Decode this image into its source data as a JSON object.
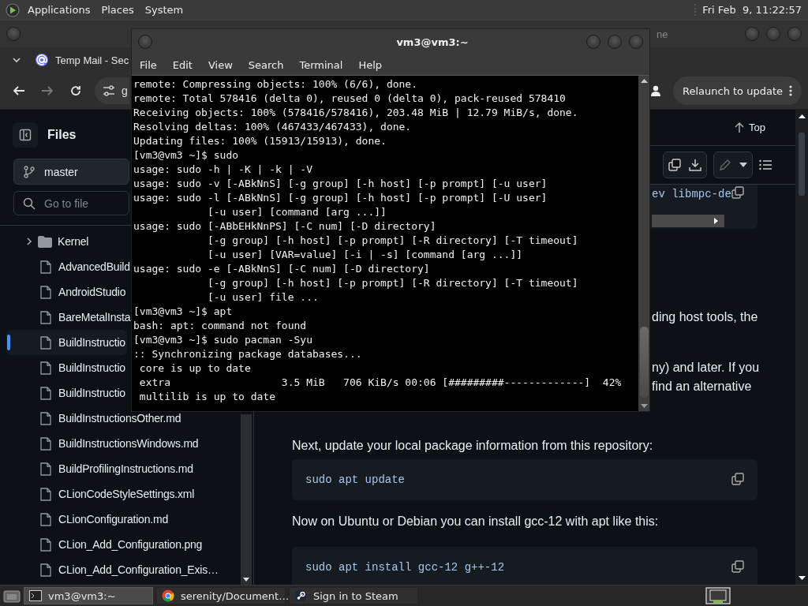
{
  "top_panel": {
    "menus": [
      "Applications",
      "Places",
      "System"
    ],
    "clock": "Fri Feb  9, 11:22:57"
  },
  "browser": {
    "title": "ne",
    "tab": {
      "title": "Temp Mail - Sec"
    },
    "nav": [
      {
        "kind": "back",
        "disabled": false
      },
      {
        "kind": "forward",
        "disabled": true
      },
      {
        "kind": "reload",
        "disabled": false
      }
    ],
    "address": "g",
    "update_button": "Relaunch to update",
    "sidebar": {
      "title": "Files",
      "branch": "master",
      "search": {
        "placeholder": "Go to file"
      },
      "tree": [
        {
          "name": "Kernel",
          "kind": "folder",
          "expanded": false,
          "selected": false
        },
        {
          "name": "AdvancedBuild",
          "kind": "file",
          "selected": false
        },
        {
          "name": "AndroidStudio",
          "kind": "file",
          "selected": false
        },
        {
          "name": "BareMetalInsta",
          "kind": "file",
          "selected": false
        },
        {
          "name": "BuildInstructio",
          "kind": "file",
          "selected": true
        },
        {
          "name": "BuildInstructio",
          "kind": "file",
          "selected": false
        },
        {
          "name": "BuildInstructio",
          "kind": "file",
          "selected": false
        },
        {
          "name": "BuildInstructionsOther.md",
          "kind": "file",
          "selected": false
        },
        {
          "name": "BuildInstructionsWindows.md",
          "kind": "file",
          "selected": false
        },
        {
          "name": "BuildProfilingInstructions.md",
          "kind": "file",
          "selected": false
        },
        {
          "name": "CLionCodeStyleSettings.xml",
          "kind": "file",
          "selected": false
        },
        {
          "name": "CLionConfiguration.md",
          "kind": "file",
          "selected": false
        },
        {
          "name": "CLion_Add_Configuration.png",
          "kind": "file",
          "selected": false
        },
        {
          "name": "CLion_Add_Configuration_Exis…",
          "kind": "file",
          "selected": false
        }
      ]
    },
    "content": {
      "top_button": "Top",
      "code_fragment": "ev libmpc-de",
      "fragments": [
        "ding host tools, the",
        "ny) and later. If you",
        "find an alternative"
      ],
      "blocks": [
        {
          "kind": "text",
          "text": "Next, update your local package information from this repository:"
        },
        {
          "kind": "code",
          "text": "sudo apt update"
        },
        {
          "kind": "text",
          "text": "Now on Ubuntu or Debian you can install gcc-12 with apt like this:"
        },
        {
          "kind": "code",
          "text": "sudo apt install gcc-12 g++-12"
        }
      ]
    }
  },
  "terminal": {
    "title": "vm3@vm3:~",
    "menu": [
      "File",
      "Edit",
      "View",
      "Search",
      "Terminal",
      "Help"
    ],
    "lines": [
      "remote: Compressing objects: 100% (6/6), done.",
      "remote: Total 578416 (delta 0), reused 0 (delta 0), pack-reused 578410",
      "Receiving objects: 100% (578416/578416), 203.48 MiB | 12.79 MiB/s, done.",
      "Resolving deltas: 100% (467433/467433), done.",
      "Updating files: 100% (15913/15913), done.",
      "[vm3@vm3 ~]$ sudo",
      "usage: sudo -h | -K | -k | -V",
      "usage: sudo -v [-ABkNnS] [-g group] [-h host] [-p prompt] [-u user]",
      "usage: sudo -l [-ABkNnS] [-g group] [-h host] [-p prompt] [-U user]",
      "            [-u user] [command [arg ...]]",
      "usage: sudo [-ABbEHkNnPS] [-C num] [-D directory]",
      "            [-g group] [-h host] [-p prompt] [-R directory] [-T timeout]",
      "            [-u user] [VAR=value] [-i | -s] [command [arg ...]]",
      "usage: sudo -e [-ABkNnS] [-C num] [-D directory]",
      "            [-g group] [-h host] [-p prompt] [-R directory] [-T timeout]",
      "            [-u user] file ...",
      "[vm3@vm3 ~]$ apt",
      "bash: apt: command not found",
      "[vm3@vm3 ~]$ sudo pacman -Syu",
      ":: Synchronizing package databases...",
      " core is up to date",
      " extra                  3.5 MiB   706 KiB/s 00:06 [#########-------------]  42%",
      " multilib is up to date"
    ]
  },
  "taskbar": {
    "tasks": [
      {
        "label": "vm3@vm3:~",
        "kind": "terminal",
        "selected": true
      },
      {
        "label": "serenity/Document…",
        "kind": "browser",
        "selected": false
      },
      {
        "label": "Sign in to Steam",
        "kind": "steam",
        "selected": false
      }
    ]
  }
}
